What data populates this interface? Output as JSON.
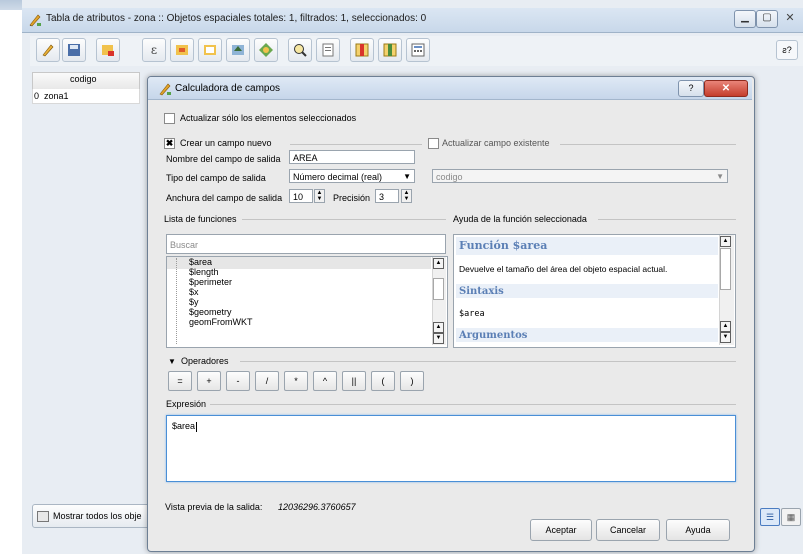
{
  "background_window": {
    "title": "Tabla de atributos - zona :: Objetos espaciales totales: 1, filtrados: 1, seleccionados: 0",
    "table": {
      "column": "codigo",
      "row_index": "0",
      "row_value": "zona1"
    },
    "show_all_button": "Mostrar todos los obje",
    "help_badge": "ƨ?"
  },
  "dialog": {
    "title": "Calculadora de campos",
    "update_selected_only": "Actualizar sólo los elementos seleccionados",
    "create_new_field": "Crear un campo nuevo",
    "update_existing_field": "Actualizar campo existente",
    "existing_field_value": "codigo",
    "output_field_name_label": "Nombre del campo de salida",
    "output_field_name": "AREA",
    "output_field_type_label": "Tipo del campo de salida",
    "output_field_type": "Número decimal (real)",
    "output_field_width_label": "Anchura del campo de salida",
    "output_field_width": "10",
    "precision_label": "Precisión",
    "precision": "3",
    "function_list_label": "Lista de funciones",
    "search_placeholder": "Buscar",
    "functions": [
      "$area",
      "$length",
      "$perimeter",
      "$x",
      "$y",
      "$geometry",
      "geomFromWKT"
    ],
    "help_label": "Ayuda de la función seleccionada",
    "help": {
      "heading": "Función $area",
      "description": "Devuelve el tamaño del área del objeto espacial actual.",
      "syntax_heading": "Sintaxis",
      "syntax": "$area",
      "arguments_heading": "Argumentos"
    },
    "operators_label": "Operadores",
    "operators": [
      "=",
      "+",
      "-",
      "/",
      "*",
      "^",
      "||",
      "(",
      ")"
    ],
    "expression_label": "Expresión",
    "expression": "$area",
    "preview_label": "Vista previa de la salida:",
    "preview_value": "12036296.3760657",
    "buttons": {
      "ok": "Aceptar",
      "cancel": "Cancelar",
      "help": "Ayuda"
    },
    "title_help": "?"
  }
}
